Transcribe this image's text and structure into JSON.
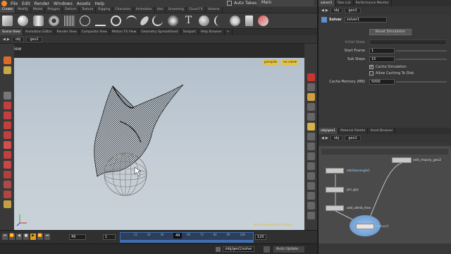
{
  "menu": [
    "File",
    "Edit",
    "Render",
    "Windows",
    "Assets",
    "Help"
  ],
  "auto_takes": "Auto Takes",
  "desktop": "Main",
  "shelf_tabs": [
    "Create",
    "Modify",
    "Model",
    "Polygon",
    "Deform",
    "Texture",
    "Rigging",
    "Character",
    "Animation",
    "Hair",
    "Grooming",
    "Cloud FX",
    "Volume"
  ],
  "pane_tabs": [
    "Scene View",
    "Animation Editor",
    "Render View",
    "Composite View",
    "Motion FX View",
    "Geometry Spreadsheet",
    "Textport",
    "Help Browser"
  ],
  "path": {
    "obj": "obj",
    "geo": "geo1"
  },
  "view_label": "View",
  "viewport": {
    "persp": "persp1▾",
    "cam": "no cam▾",
    "watermark": "Non-Commercial Edition"
  },
  "timeline": {
    "current": "49",
    "start": "1",
    "end": "120",
    "ticks": [
      "12",
      "24",
      "36",
      "48",
      "60",
      "72",
      "84",
      "96",
      "108"
    ],
    "playhead": "49",
    "progress": 0.4
  },
  "status": {
    "path": "/obj/geo1/solve",
    "auto_update": "Auto Update"
  },
  "right_top_tabs": [
    "solver1",
    "Take List",
    "Performance Monitor"
  ],
  "param_path": {
    "obj": "obj",
    "geo": "geo1"
  },
  "solver": {
    "type": "Solver",
    "name": "solver1",
    "reset_label": "Reset Simulation"
  },
  "params": {
    "initial_state_label": "Initial State",
    "start_frame_label": "Start Frame",
    "start_frame": "1",
    "sub_steps_label": "Sub Steps",
    "sub_steps": "15",
    "cache_sim_label": "Cache Simulation",
    "allow_cache_label": "Allow Caching To Disk",
    "cache_mem_label": "Cache Memory (MB)",
    "cache_mem": "5000"
  },
  "net_tabs": [
    "/obj/geo1",
    "Material Palette",
    "Asset Browser"
  ],
  "net_path": {
    "obj": "obj",
    "geo": "geo1"
  },
  "nodes": {
    "attribwrangle": "attribwrangle1",
    "pin": "pin_grp",
    "add_attrib": "add_attrib_free",
    "solver": "solver1",
    "edit": "edit_rmpoly_geo2"
  },
  "colors": {
    "accent": "#f2b12c",
    "playbar": "#3c6fb4",
    "selection": "#7aa6d8"
  }
}
